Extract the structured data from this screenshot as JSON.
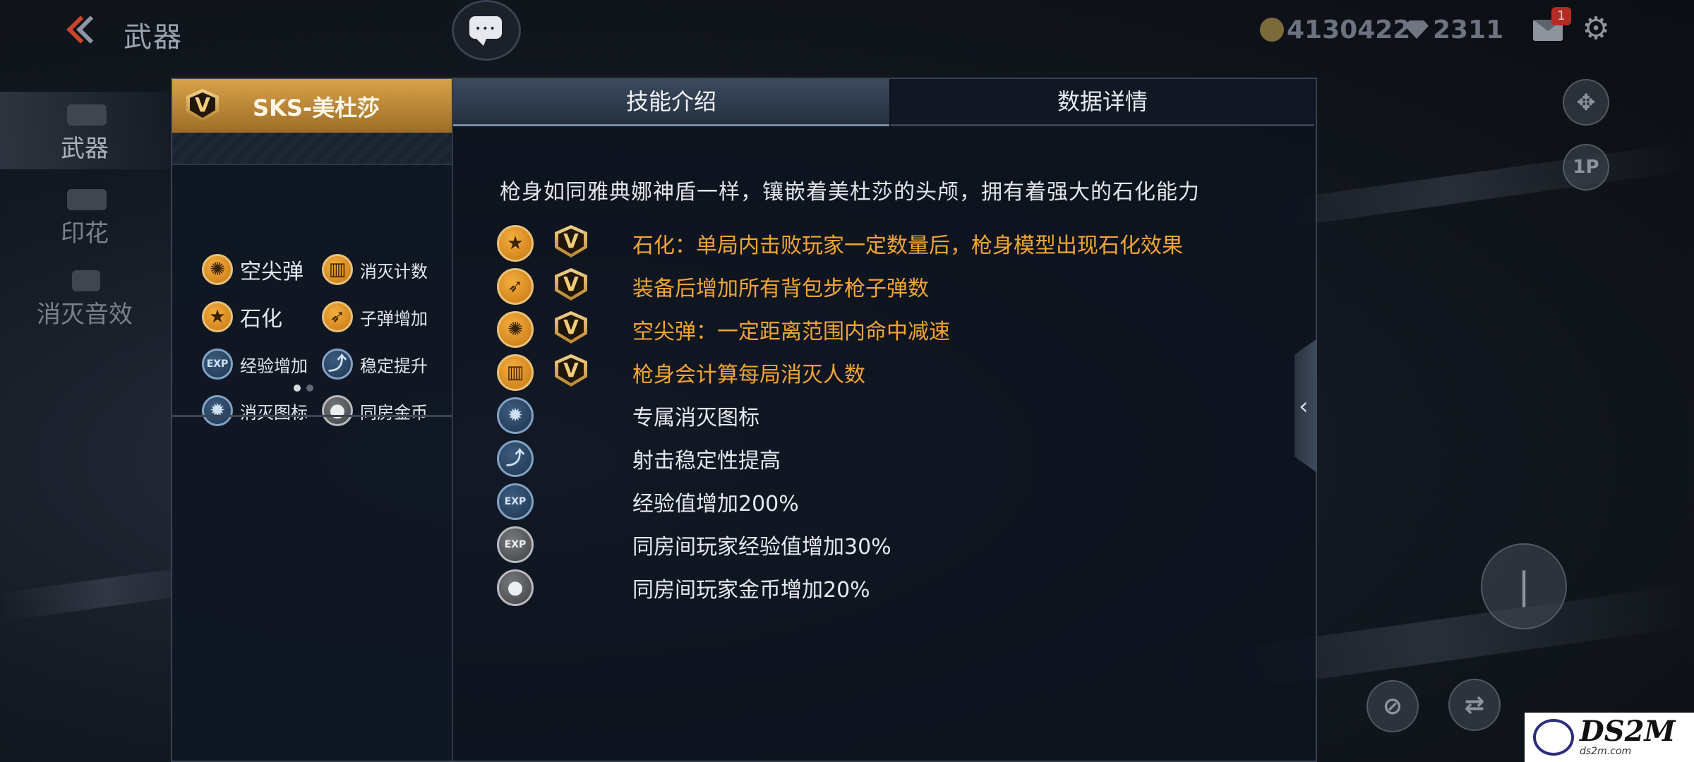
{
  "topbar": {
    "title": "武器",
    "gold": "4130422",
    "gems": "2311",
    "mail_badge": "1"
  },
  "side_nav": [
    {
      "label": "武器",
      "active": true
    },
    {
      "label": "印花",
      "active": false
    },
    {
      "label": "消灭音效",
      "active": false
    }
  ],
  "weapon": {
    "badge": "V",
    "name": "SKS-美杜莎"
  },
  "traits": [
    {
      "label": "空尖弹",
      "icon": "hollow-point-icon"
    },
    {
      "label": "消灭计数",
      "icon": "kill-counter-icon"
    },
    {
      "label": "石化",
      "icon": "star-icon"
    },
    {
      "label": "子弹增加",
      "icon": "bullet-increase-icon"
    },
    {
      "label": "经验增加",
      "icon": "exp-icon"
    },
    {
      "label": "稳定提升",
      "icon": "stability-icon"
    },
    {
      "label": "消灭图标",
      "icon": "kill-icon"
    },
    {
      "label": "同房金币",
      "icon": "room-coin-icon"
    }
  ],
  "tabs": [
    {
      "label": "技能介绍",
      "active": true
    },
    {
      "label": "数据详情",
      "active": false
    }
  ],
  "description": "枪身如同雅典娜神盾一样，镶嵌着美杜莎的头颅，拥有着强大的石化能力",
  "skills": [
    {
      "text": "石化：单局内击败玩家一定数量后，枪身模型出现石化效果",
      "icon": "star-icon",
      "vip": true
    },
    {
      "text": "装备后增加所有背包步枪子弹数",
      "icon": "bullet-increase-icon",
      "vip": true
    },
    {
      "text": "空尖弹：一定距离范围内命中减速",
      "icon": "hollow-point-icon",
      "vip": true
    },
    {
      "text": "枪身会计算每局消灭人数",
      "icon": "kill-counter-icon",
      "vip": true
    },
    {
      "text": "专属消灭图标",
      "icon": "kill-icon",
      "vip": false
    },
    {
      "text": "射击稳定性提高",
      "icon": "stability-icon",
      "vip": false
    },
    {
      "text": "经验值增加200%",
      "icon": "exp-icon",
      "vip": false
    },
    {
      "text": "同房间玩家经验值增加30%",
      "icon": "room-exp-icon",
      "vip": false
    },
    {
      "text": "同房间玩家金币增加20%",
      "icon": "room-coin-icon",
      "vip": false
    }
  ],
  "right_controls": {
    "one_p": "1P"
  },
  "watermark": {
    "big": "DS2M",
    "small": "ds2m.com"
  },
  "icon_glyphs": {
    "exp": "EXP"
  },
  "colors": {
    "gold_text": "#f1a535",
    "tab_active": "#3c4a5e"
  }
}
